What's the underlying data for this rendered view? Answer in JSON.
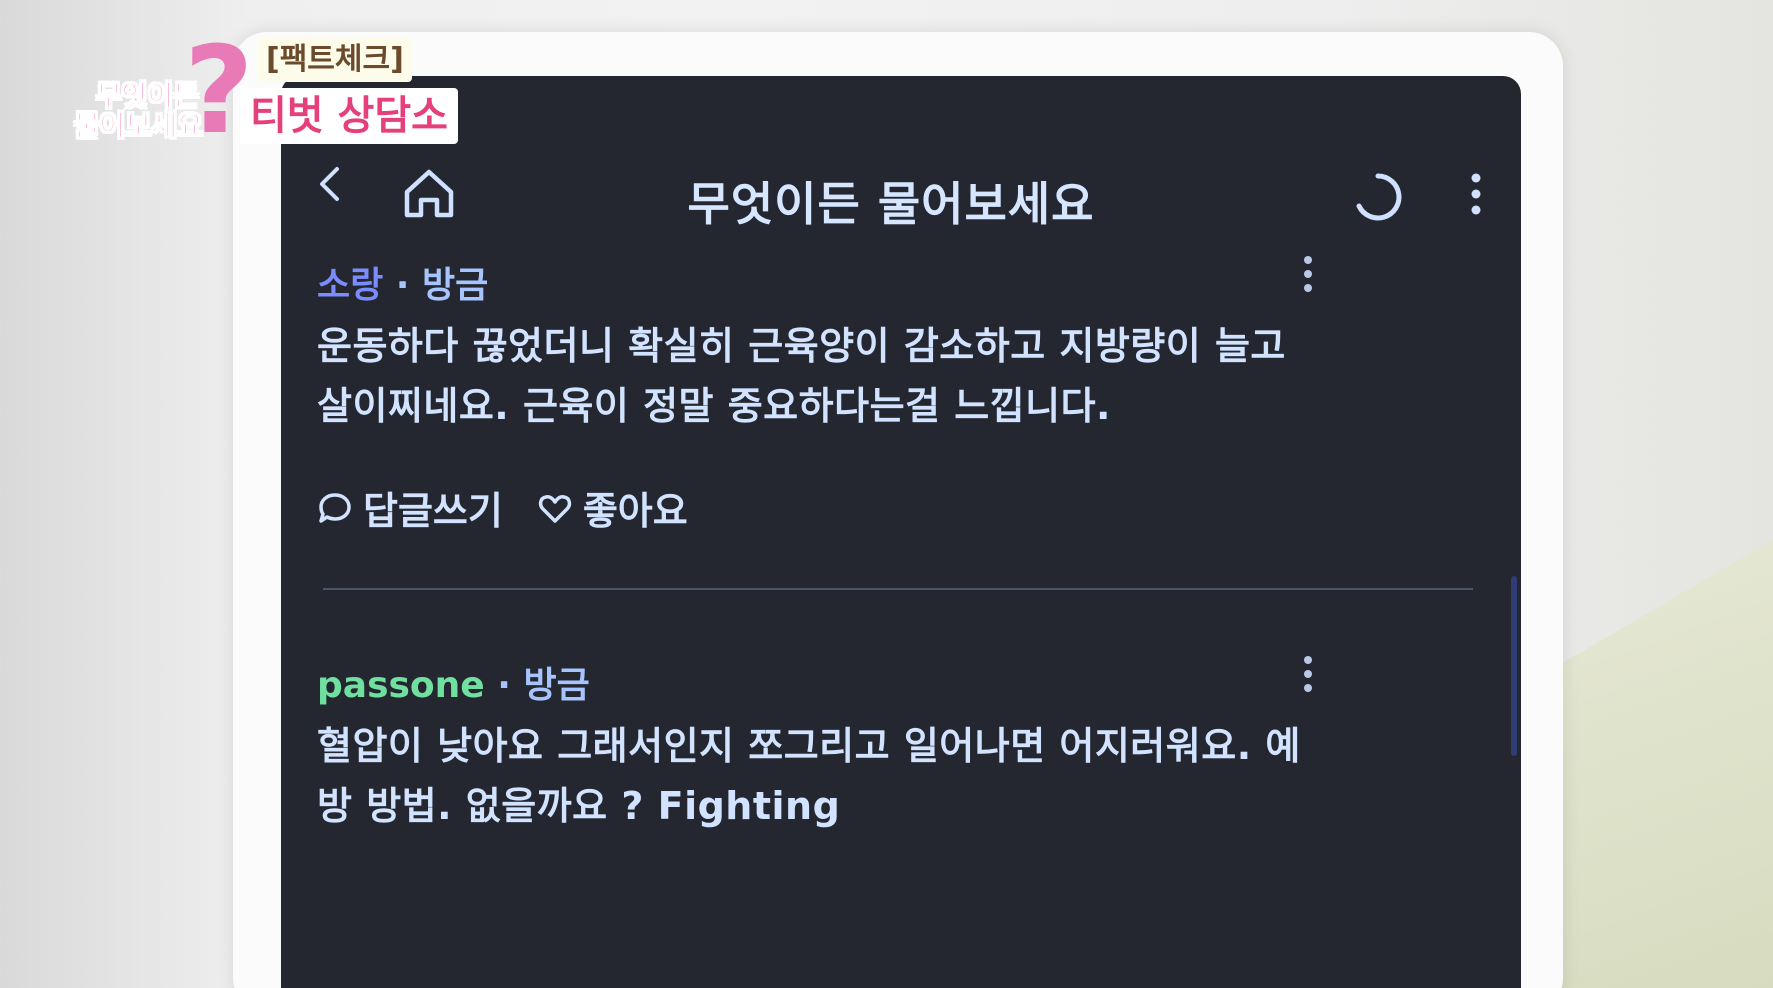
{
  "overlay": {
    "logo_line1": "무엇이든",
    "logo_line2": "물어보세요",
    "tag_top": "[팩트체크]",
    "tag_main": "티벗 상담소"
  },
  "header": {
    "title": "무엇이든 물어보세요",
    "icons": [
      "back-icon",
      "home-icon",
      "refresh-icon",
      "more-vertical-icon"
    ]
  },
  "posts": [
    {
      "author": "소랑",
      "separator": "·",
      "time": "방금",
      "body_line1": "운동하다 끊었더니 확실히 근육양이 감소하고 지방량이 늘고",
      "body_line2": "살이찌네요. 근육이 정말 중요하다는걸 느낍니다.",
      "reply_label": "답글쓰기",
      "like_label": "좋아요",
      "author_color": "#7b8cff"
    },
    {
      "author": "passone",
      "separator": "·",
      "time": "방금",
      "body_line1": "혈압이 낮아요 그래서인지 쪼그리고  일어나면 어지러워요. 예",
      "body_line2": "방 방법. 없을까요 ? Fighting",
      "author_color": "#6fe0a0"
    }
  ],
  "colors": {
    "screen_bg": "#24272f",
    "text": "#d2e3ff",
    "divider": "#4b5464"
  }
}
